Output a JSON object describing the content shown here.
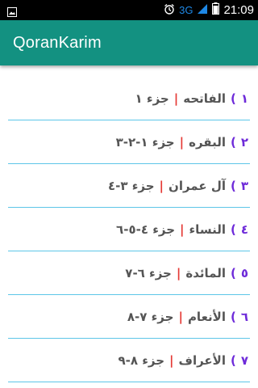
{
  "status_bar": {
    "network": "3G",
    "time": "21:09",
    "icons": [
      "image-icon",
      "alarm-icon",
      "signal-icon",
      "battery-icon"
    ]
  },
  "app_bar": {
    "title": "QoranKarim",
    "background": "#139181"
  },
  "colors": {
    "number": "#6e2bd9",
    "separator": "#e53935",
    "text": "#555555",
    "divider": "#5dc6e8"
  },
  "surahs": [
    {
      "number": "١",
      "paren": ")",
      "name": "الفاتحه",
      "separator": "|",
      "juz": "جزء ١"
    },
    {
      "number": "٢",
      "paren": ")",
      "name": "البقره",
      "separator": "|",
      "juz": "جزء ١-٢-٣"
    },
    {
      "number": "٣",
      "paren": ")",
      "name": "آل عمران",
      "separator": "|",
      "juz": "جزء ٣-٤"
    },
    {
      "number": "٤",
      "paren": ")",
      "name": "النساء",
      "separator": "|",
      "juz": "جزء ٤-٥-٦"
    },
    {
      "number": "٥",
      "paren": ")",
      "name": "المائدة",
      "separator": "|",
      "juz": "جزء ٦-٧"
    },
    {
      "number": "٦",
      "paren": ")",
      "name": "الأنعام",
      "separator": "|",
      "juz": "جزء ٧-٨"
    },
    {
      "number": "٧",
      "paren": ")",
      "name": "الأعراف",
      "separator": "|",
      "juz": "جزء ٨-٩"
    }
  ]
}
